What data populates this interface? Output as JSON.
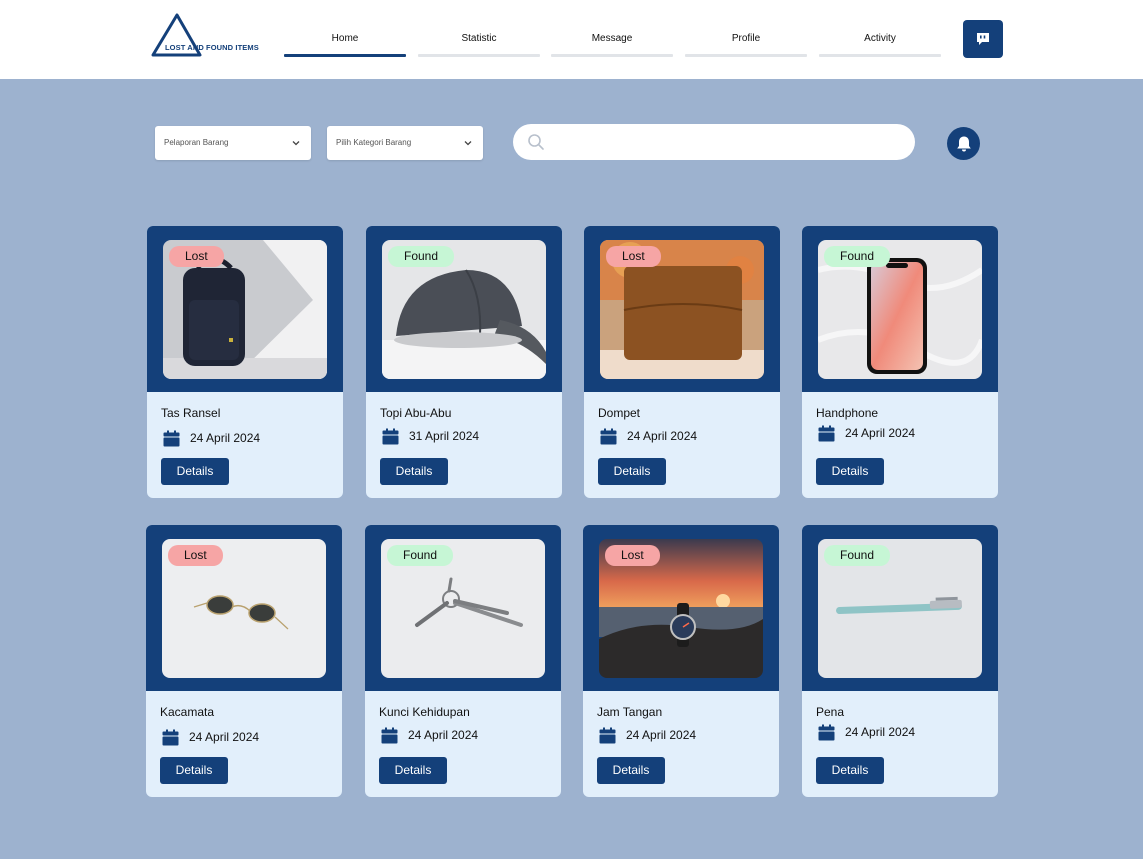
{
  "logo": {
    "text": "LOST AND FOUND ITEMS",
    "color": "#14407a"
  },
  "nav": {
    "items": [
      {
        "label": "Home",
        "active": true
      },
      {
        "label": "Statistic",
        "active": false
      },
      {
        "label": "Message",
        "active": false
      },
      {
        "label": "Profile",
        "active": false
      },
      {
        "label": "Activity",
        "active": false
      }
    ]
  },
  "header": {
    "chat_icon": "chat-alert-icon"
  },
  "filters": {
    "report": {
      "value": "Pelaporan Barang"
    },
    "category": {
      "value": "Pilih Kategori Barang"
    }
  },
  "search": {
    "placeholder": "",
    "icon": "search-icon"
  },
  "notifications": {
    "icon": "bell-icon"
  },
  "colors": {
    "primary": "#14407a",
    "background": "#9db2cf",
    "card": "#e2effb",
    "lost": "#f6a5a5",
    "found": "#c6f6d5"
  },
  "items": [
    {
      "status": "Lost",
      "name": "Tas Ransel",
      "date": "24 April 2024",
      "details_label": "Details",
      "image": "backpack"
    },
    {
      "status": "Found",
      "name": "Topi Abu-Abu",
      "date": "31 April 2024",
      "details_label": "Details",
      "image": "cap"
    },
    {
      "status": "Lost",
      "name": "Dompet",
      "date": "24 April 2024",
      "details_label": "Details",
      "image": "wallet"
    },
    {
      "status": "Found",
      "name": "Handphone",
      "date": "24 April 2024",
      "details_label": "Details",
      "image": "phone"
    },
    {
      "status": "Lost",
      "name": "Kacamata",
      "date": "24 April 2024",
      "details_label": "Details",
      "image": "sunglasses"
    },
    {
      "status": "Found",
      "name": "Kunci Kehidupan",
      "date": "24 April 2024",
      "details_label": "Details",
      "image": "keys"
    },
    {
      "status": "Lost",
      "name": "Jam Tangan",
      "date": "24 April 2024",
      "details_label": "Details",
      "image": "watch"
    },
    {
      "status": "Found",
      "name": "Pena",
      "date": "24 April 2024",
      "details_label": "Details",
      "image": "pen"
    }
  ]
}
